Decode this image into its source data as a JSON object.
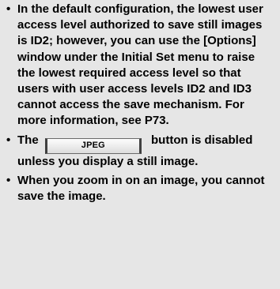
{
  "notes": {
    "bullet": "•",
    "item1": "In the default configuration, the lowest user access level authorized to save still images is ID2; however, you can use the [Options] window under the Initial Set menu to raise the lowest required access level so that users with user access levels ID2 and ID3 cannot access the save mechanism. For more information, see P73.",
    "item2_before": "The",
    "item2_button": "JPEG",
    "item2_after": "button is disabled unless you display a still image.",
    "item3": "When you zoom in on an image, you cannot save the image."
  }
}
